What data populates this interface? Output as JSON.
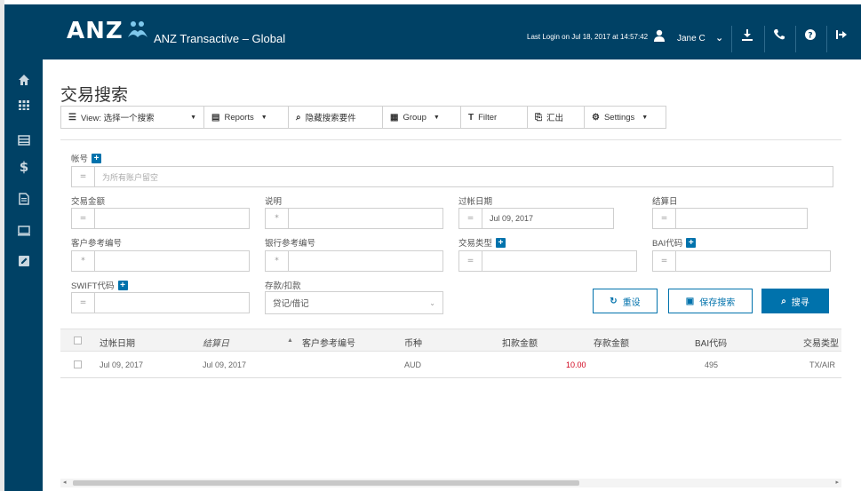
{
  "header": {
    "brand": "ANZ",
    "app_title": "ANZ Transactive – Global",
    "last_login": "Last Login on Jul 18, 2017 at 14:57:42",
    "user_name": "Jane C",
    "icons": [
      "user-icon",
      "chevron-down-icon",
      "download-icon",
      "phone-icon",
      "help-icon",
      "logout-icon"
    ]
  },
  "sidebar": {
    "items": [
      "home-icon",
      "grid-icon",
      "list-icon",
      "dollar-icon",
      "document-icon",
      "monitor-icon",
      "edit-icon"
    ]
  },
  "page": {
    "title": "交易搜索"
  },
  "toolbar": {
    "view_label": "View: 选择一个搜索",
    "reports_label": "Reports",
    "hide_search_label": "隐藏搜索要件",
    "group_label": "Group",
    "filter_label": "Filter",
    "export_label": "汇出",
    "settings_label": "Settings"
  },
  "search": {
    "account_label": "帐号",
    "account_placeholder": "为所有账户留空",
    "amount_label": "交易金额",
    "description_label": "说明",
    "posting_date_label": "过帐日期",
    "posting_date_value": "Jul 09, 2017",
    "settlement_date_label": "结算日",
    "customer_ref_label": "客户参考编号",
    "bank_ref_label": "银行参考编号",
    "txn_type_label": "交易类型",
    "bai_code_label": "BAI代码",
    "swift_code_label": "SWIFT代码",
    "deposit_label": "存款/扣款",
    "deposit_value": "贷记/借记",
    "op_equals": "=",
    "op_star": "*",
    "reset_label": "重设",
    "save_label": "保存搜索",
    "search_label": "搜寻"
  },
  "table": {
    "columns": [
      "过帐日期",
      "结算日",
      "客户参考编号",
      "币种",
      "扣款金额",
      "存款金额",
      "BAI代码",
      "交易类型"
    ],
    "rows": [
      {
        "posting_date": "Jul 09, 2017",
        "settlement_date": "Jul 09, 2017",
        "customer_ref": "",
        "currency": "AUD",
        "debit": "10.00",
        "credit": "",
        "bai_code": "495",
        "txn_type": "TX/AIR"
      }
    ]
  },
  "colors": {
    "brand_navy": "#004165",
    "accent_blue": "#0072ac",
    "debit_red": "#d0021b"
  }
}
